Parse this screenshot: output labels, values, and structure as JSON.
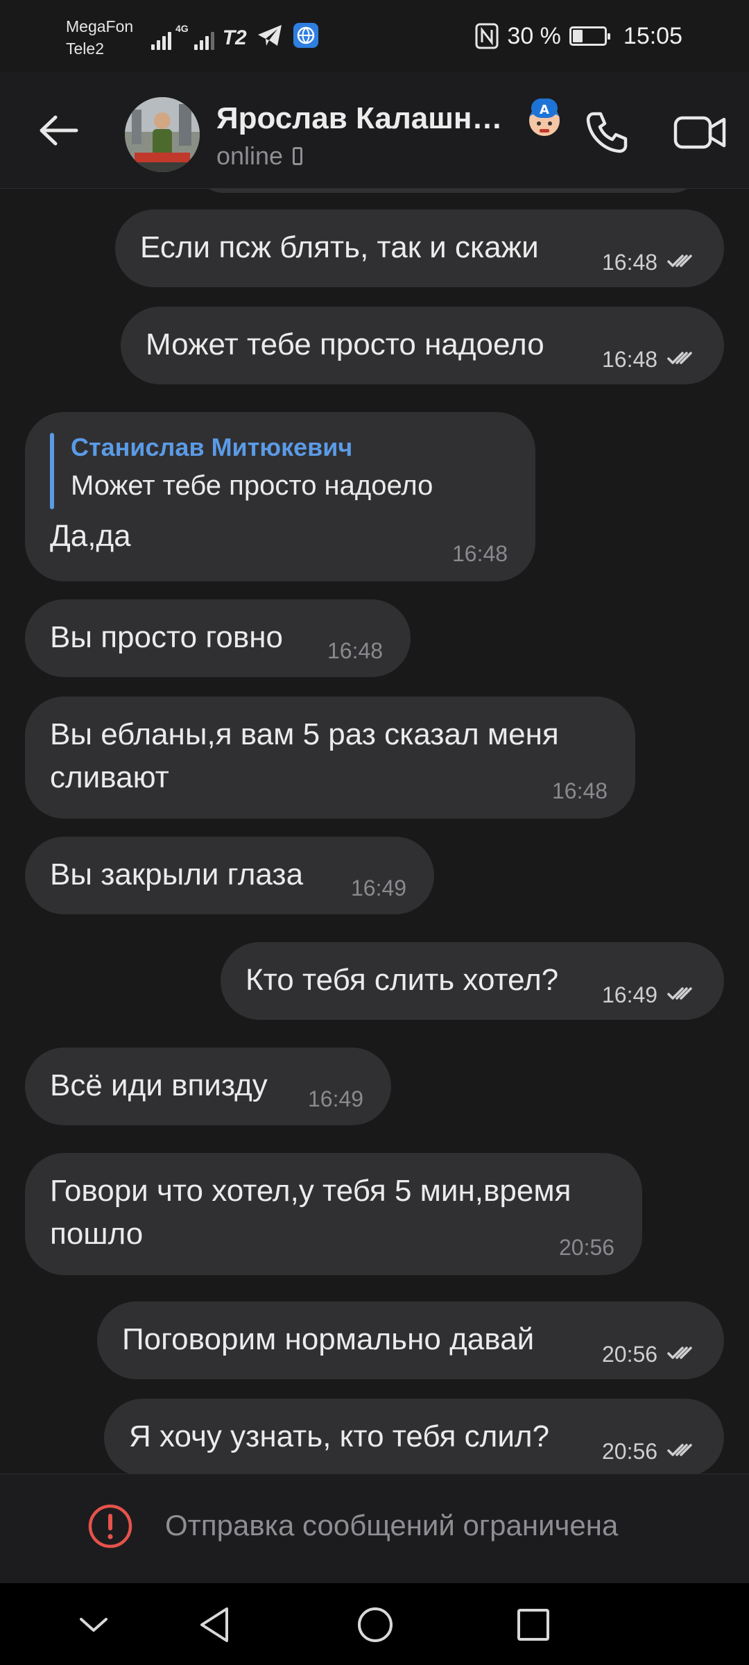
{
  "status_bar": {
    "carrier_1": "MegaFon",
    "carrier_2": "Tele2",
    "net_1": "4G",
    "net_2": "T2",
    "nfc_label": "N",
    "battery": "30 %",
    "time": "15:05"
  },
  "header": {
    "name": "Ярослав Калашн…",
    "status": "online"
  },
  "messages": [
    {
      "text": "Если псж блять, так и скажи",
      "time": "16:48",
      "direction": "out"
    },
    {
      "text": "Может тебе просто надоело",
      "time": "16:48",
      "direction": "out"
    },
    {
      "reply_author": "Станислав Митюкевич",
      "reply_text": "Может тебе просто надоело",
      "text": "Да,да",
      "time": "16:48",
      "direction": "in"
    },
    {
      "text": "Вы просто говно",
      "time": "16:48",
      "direction": "in"
    },
    {
      "text_line1": "Вы ебланы,я вам 5 раз сказал меня",
      "text_line2": "сливают",
      "time": "16:48",
      "direction": "in"
    },
    {
      "text": "Вы закрыли глаза",
      "time": "16:49",
      "direction": "in"
    },
    {
      "text": "Кто тебя слить хотел?",
      "time": "16:49",
      "direction": "out"
    },
    {
      "text": "Всё иди впизду",
      "time": "16:49",
      "direction": "in"
    },
    {
      "text_line1": "Говори что хотел,у тебя 5 мин,время",
      "text_line2": "пошло",
      "time": "20:56",
      "direction": "in"
    },
    {
      "text": "Поговорим нормально давай",
      "time": "20:56",
      "direction": "out"
    },
    {
      "text": "Я хочу узнать, кто тебя слил?",
      "time": "20:56",
      "direction": "out"
    }
  ],
  "restriction": {
    "text": "Отправка сообщений ограничена"
  },
  "colors": {
    "background": "#19191a",
    "bubble": "#303033",
    "accent": "#5b9be6",
    "warning": "#e5534b"
  }
}
